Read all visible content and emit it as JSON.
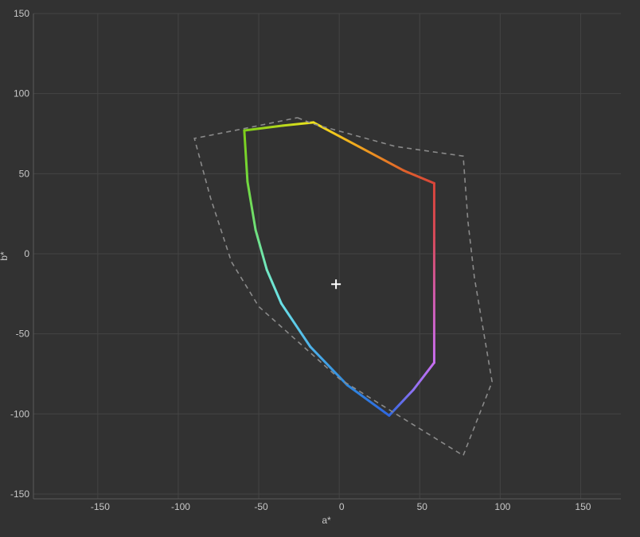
{
  "chart_data": {
    "type": "line",
    "xlabel": "a*",
    "ylabel": "b*",
    "xlim": [
      -190,
      175
    ],
    "ylim": [
      -153,
      150
    ],
    "x_ticks": [
      -150,
      -100,
      -50,
      0,
      50,
      100,
      150
    ],
    "y_ticks": [
      150,
      100,
      50,
      0,
      -50,
      -100,
      -150
    ],
    "grid": true,
    "white_point": {
      "a": -2,
      "b": -19
    },
    "series": [
      {
        "style": "gradient",
        "points": [
          {
            "a": -16,
            "b": 82,
            "color": "#f2e41c"
          },
          {
            "a": 12,
            "b": 67,
            "color": "#f0a51e"
          },
          {
            "a": 40,
            "b": 52,
            "color": "#e0622a"
          },
          {
            "a": 59,
            "b": 44,
            "color": "#d8453a"
          },
          {
            "a": 59,
            "b": 10,
            "color": "#d64a5a"
          },
          {
            "a": 59,
            "b": -25,
            "color": "#cf5aa8"
          },
          {
            "a": 59,
            "b": -68,
            "color": "#c86ef0"
          },
          {
            "a": 46,
            "b": -85,
            "color": "#8e72f2"
          },
          {
            "a": 31,
            "b": -101,
            "color": "#2f67e0"
          },
          {
            "a": 5,
            "b": -82,
            "color": "#2f8ae0"
          },
          {
            "a": -18,
            "b": -58,
            "color": "#4fb3ea"
          },
          {
            "a": -36,
            "b": -31,
            "color": "#6ae0e6"
          },
          {
            "a": -45,
            "b": -10,
            "color": "#72e8c2"
          },
          {
            "a": -52,
            "b": 15,
            "color": "#6fe07a"
          },
          {
            "a": -57,
            "b": 45,
            "color": "#72d83e"
          },
          {
            "a": -59,
            "b": 77,
            "color": "#7ecf1a"
          },
          {
            "a": -35,
            "b": 80,
            "color": "#b8d81c"
          },
          {
            "a": -16,
            "b": 82,
            "color": "#f2e41c"
          }
        ]
      },
      {
        "style": "dashed",
        "color": "#8a8a8a",
        "points": [
          {
            "a": -26,
            "b": 85
          },
          {
            "a": -16,
            "b": 81
          },
          {
            "a": 35,
            "b": 67
          },
          {
            "a": 77,
            "b": 61
          },
          {
            "a": 80,
            "b": 20
          },
          {
            "a": 84,
            "b": -15
          },
          {
            "a": 95,
            "b": -80
          },
          {
            "a": 77,
            "b": -126
          },
          {
            "a": 40,
            "b": -103
          },
          {
            "a": 0,
            "b": -78
          },
          {
            "a": -50,
            "b": -33
          },
          {
            "a": -67,
            "b": -5
          },
          {
            "a": -80,
            "b": 35
          },
          {
            "a": -90,
            "b": 72
          },
          {
            "a": -60,
            "b": 78
          },
          {
            "a": -26,
            "b": 85
          }
        ]
      }
    ]
  }
}
